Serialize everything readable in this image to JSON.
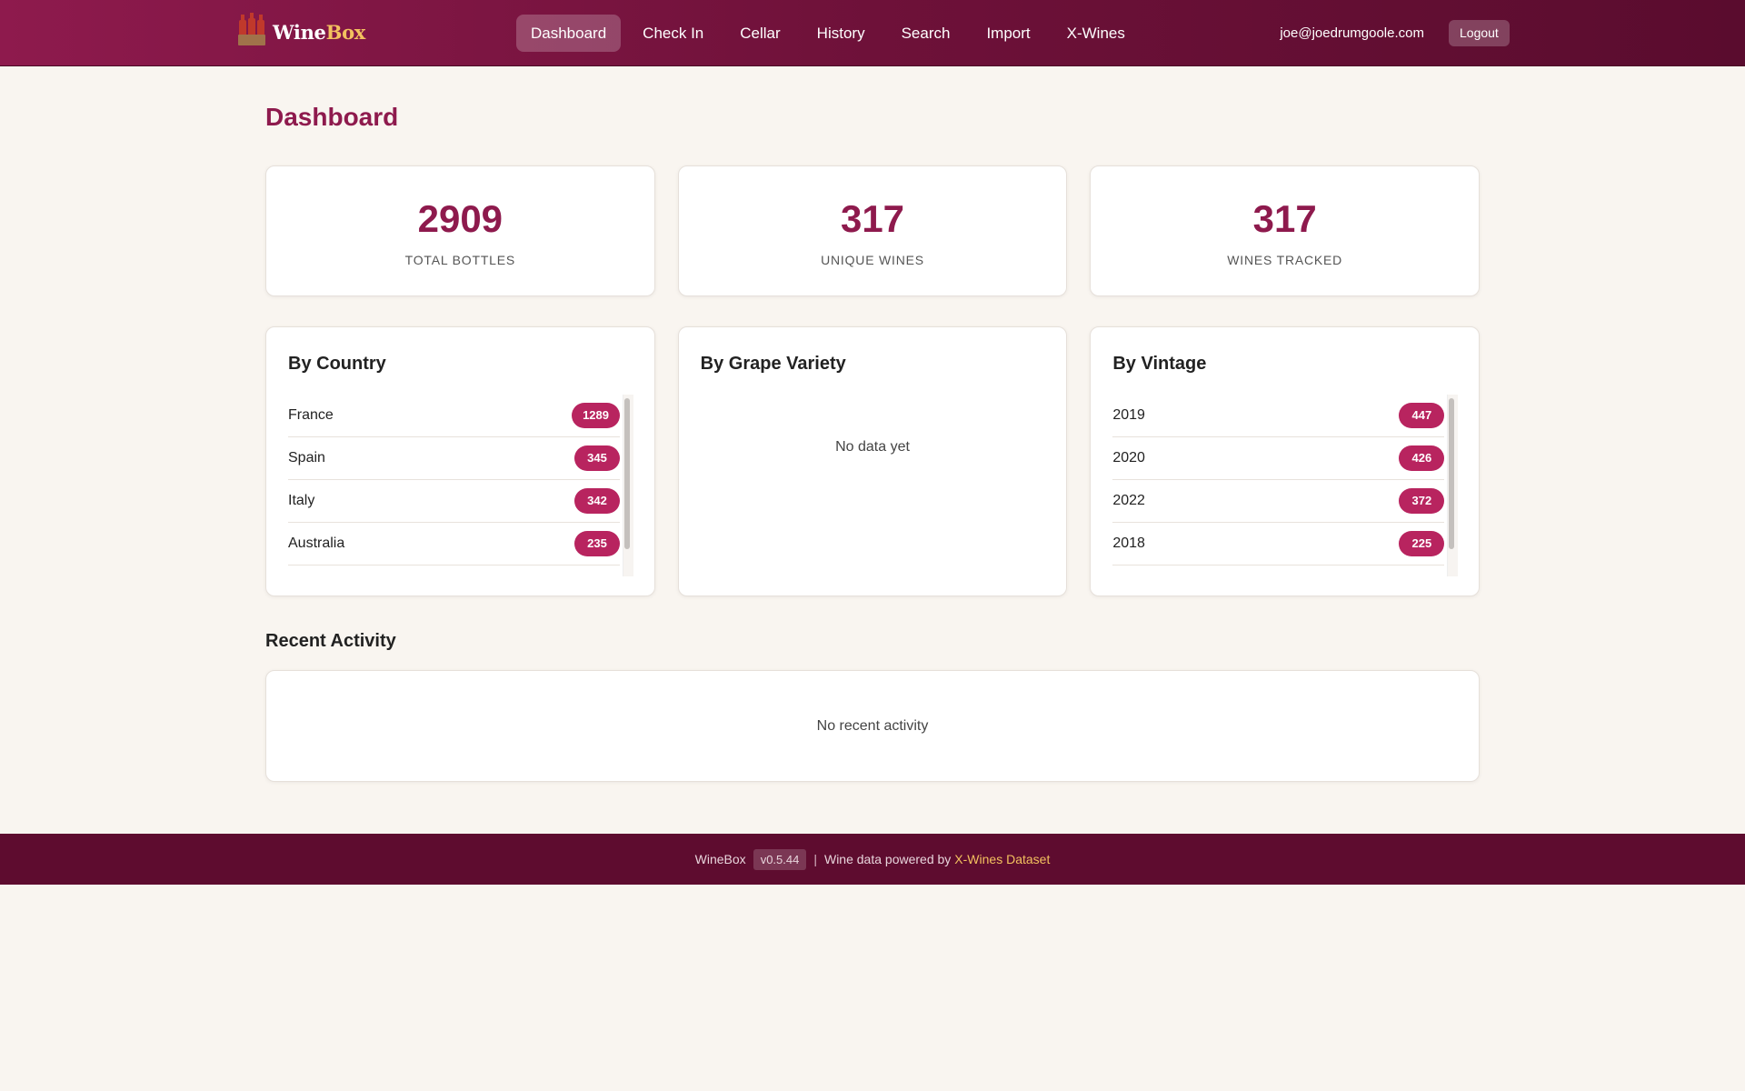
{
  "brand": {
    "name_part1": "Wine",
    "name_part2": "Box",
    "icon": "wine-crate-icon"
  },
  "nav": {
    "items": [
      {
        "label": "Dashboard",
        "active": true
      },
      {
        "label": "Check In"
      },
      {
        "label": "Cellar"
      },
      {
        "label": "History"
      },
      {
        "label": "Search"
      },
      {
        "label": "Import"
      },
      {
        "label": "X-Wines"
      }
    ]
  },
  "user": {
    "email": "joe@joedrumgoole.com",
    "logout_label": "Logout"
  },
  "page": {
    "title": "Dashboard"
  },
  "stats": [
    {
      "value": "2909",
      "label": "TOTAL BOTTLES"
    },
    {
      "value": "317",
      "label": "UNIQUE WINES"
    },
    {
      "value": "317",
      "label": "WINES TRACKED"
    }
  ],
  "by_country": {
    "title": "By Country",
    "items": [
      {
        "name": "France",
        "count": "1289"
      },
      {
        "name": "Spain",
        "count": "345"
      },
      {
        "name": "Italy",
        "count": "342"
      },
      {
        "name": "Australia",
        "count": "235"
      }
    ]
  },
  "by_grape": {
    "title": "By Grape Variety",
    "empty": "No data yet"
  },
  "by_vintage": {
    "title": "By Vintage",
    "items": [
      {
        "name": "2019",
        "count": "447"
      },
      {
        "name": "2020",
        "count": "426"
      },
      {
        "name": "2022",
        "count": "372"
      },
      {
        "name": "2018",
        "count": "225"
      }
    ]
  },
  "recent_activity": {
    "title": "Recent Activity",
    "empty": "No recent activity"
  },
  "footer": {
    "app_name": "WineBox",
    "version": "v0.5.44",
    "separator": "|",
    "powered_text": "Wine data powered by",
    "link_text": "X-Wines Dataset"
  },
  "colors": {
    "brand": "#8e1a4d",
    "badge": "#b8245f",
    "footer_bg": "#5e0c2f",
    "accent_gold": "#f3c15f",
    "page_bg": "#f9f5f0"
  }
}
